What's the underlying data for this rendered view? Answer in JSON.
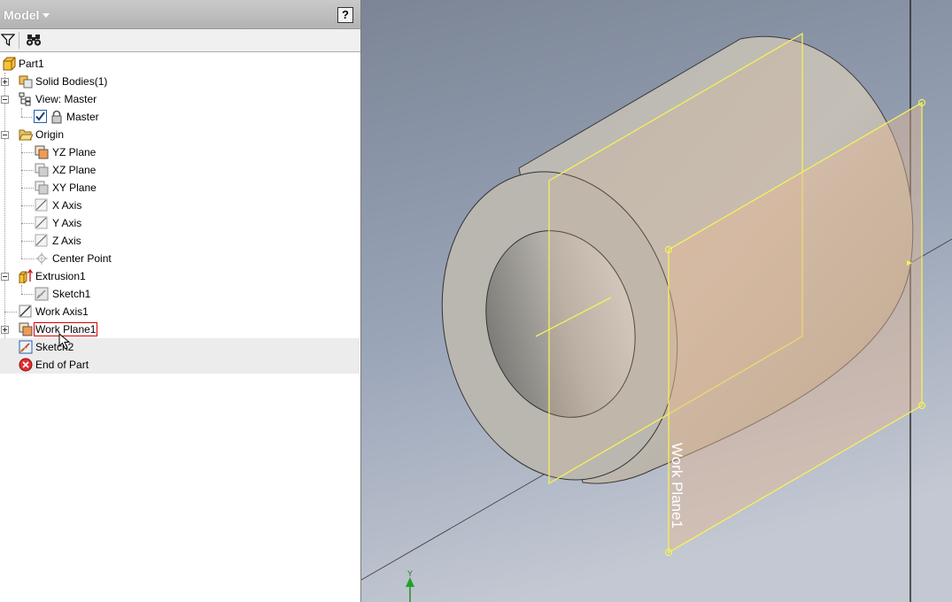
{
  "panel": {
    "title": "Model",
    "help_label": "?"
  },
  "tree": {
    "items": [
      {
        "label": "Part1"
      },
      {
        "label": "Solid Bodies(1)"
      },
      {
        "label": "View: Master"
      },
      {
        "label": "Master"
      },
      {
        "label": "Origin"
      },
      {
        "label": "YZ Plane"
      },
      {
        "label": "XZ Plane"
      },
      {
        "label": "XY Plane"
      },
      {
        "label": "X Axis"
      },
      {
        "label": "Y Axis"
      },
      {
        "label": "Z Axis"
      },
      {
        "label": "Center Point"
      },
      {
        "label": "Extrusion1"
      },
      {
        "label": "Sketch1"
      },
      {
        "label": "Work Axis1"
      },
      {
        "label": "Work Plane1"
      },
      {
        "label": "Sketch2"
      },
      {
        "label": "End of Part"
      }
    ]
  },
  "viewport": {
    "plane_label": "Work Plane1",
    "triad_label": "Y"
  },
  "colors": {
    "accent_yellow": "#f2f25a",
    "selection_red": "#d40000",
    "background_top": "#7b8596",
    "background_bottom": "#c3c8d2"
  }
}
